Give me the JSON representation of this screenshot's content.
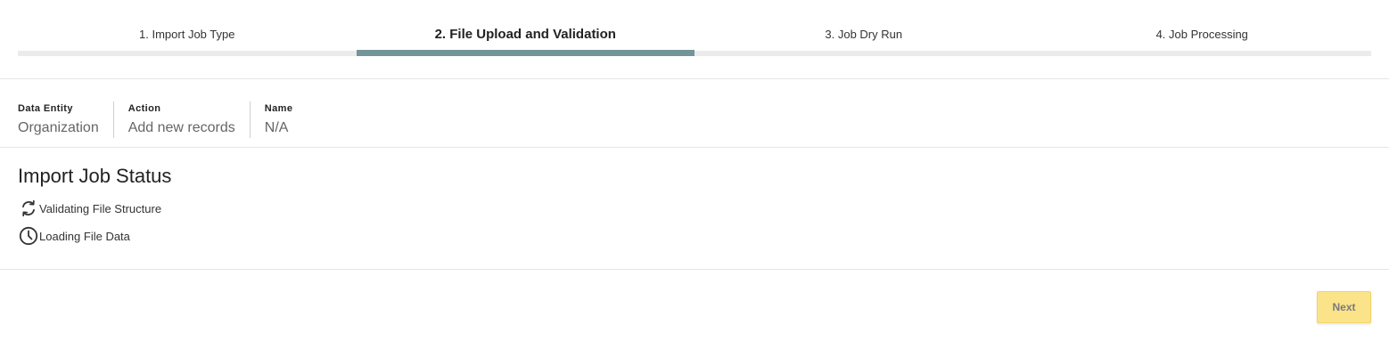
{
  "stepper": {
    "steps": [
      {
        "label": "1. Import Job Type",
        "active": false
      },
      {
        "label": "2. File Upload and Validation",
        "active": true
      },
      {
        "label": "3. Job Dry Run",
        "active": false
      },
      {
        "label": "4. Job Processing",
        "active": false
      }
    ],
    "active_color": "#739599",
    "inactive_color": "#ebebeb"
  },
  "summary": {
    "data_entity": {
      "title": "Data Entity",
      "value": "Organization"
    },
    "action": {
      "title": "Action",
      "value": "Add new records"
    },
    "name": {
      "title": "Name",
      "value": "N/A"
    }
  },
  "status": {
    "title": "Import Job Status",
    "items": [
      {
        "icon": "refresh-icon",
        "label": "Validating File Structure"
      },
      {
        "icon": "clock-icon",
        "label": "Loading File Data"
      }
    ]
  },
  "footer": {
    "next_label": "Next",
    "next_color": "#fbe38a"
  }
}
